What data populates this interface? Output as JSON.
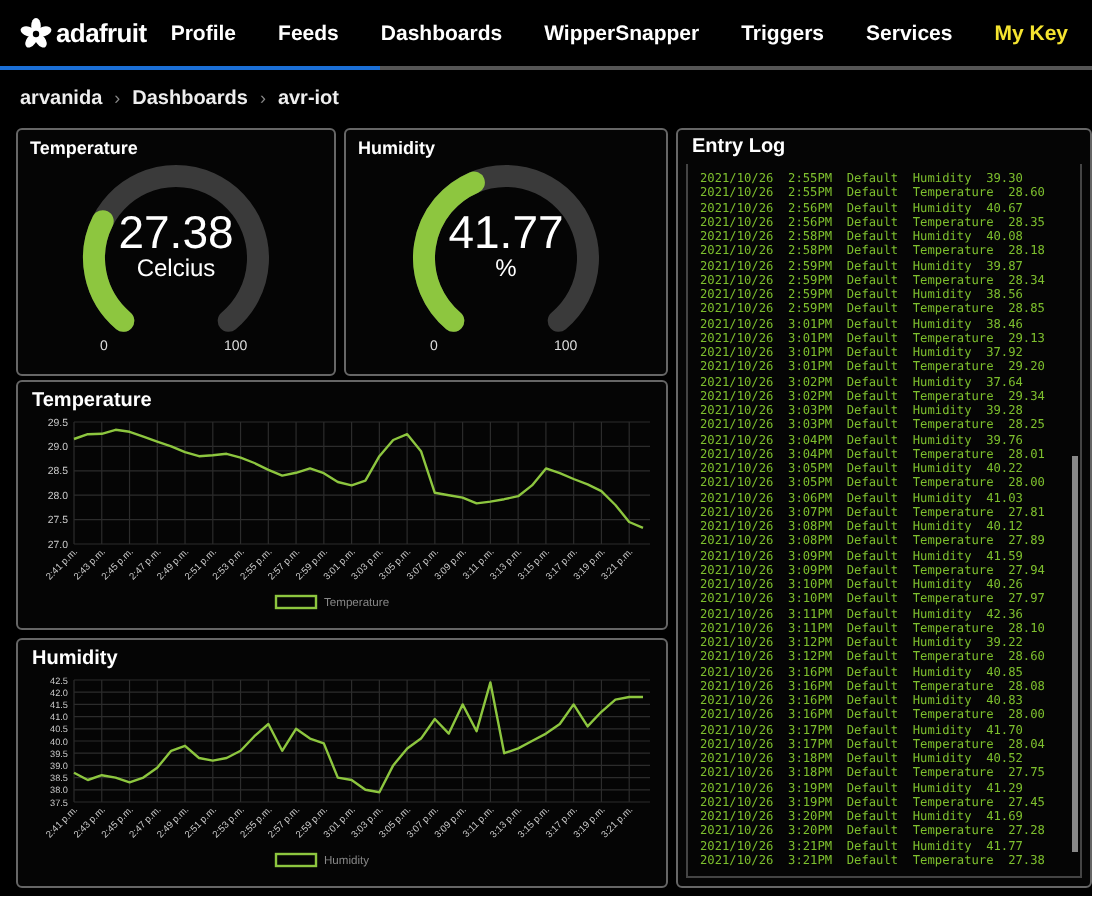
{
  "nav": {
    "logo": "adafruit",
    "items": [
      {
        "label": "Profile",
        "highlight": false
      },
      {
        "label": "Feeds",
        "highlight": false
      },
      {
        "label": "Dashboards",
        "highlight": false
      },
      {
        "label": "WipperSnapper",
        "highlight": false
      },
      {
        "label": "Triggers",
        "highlight": false
      },
      {
        "label": "Services",
        "highlight": false
      },
      {
        "label": "My Key",
        "highlight": true
      }
    ]
  },
  "breadcrumb": [
    {
      "kind": "link",
      "text": "arvanida"
    },
    {
      "kind": "separator",
      "text": "›"
    },
    {
      "kind": "link",
      "text": "Dashboards"
    },
    {
      "kind": "separator",
      "text": "›"
    },
    {
      "kind": "current",
      "text": "avr-iot"
    }
  ],
  "gauges": [
    {
      "title": "Temperature",
      "value": "27.38",
      "unit": "Celcius",
      "min": "0",
      "max": "100"
    },
    {
      "title": "Humidity",
      "value": "41.77",
      "unit": "%",
      "min": "0",
      "max": "100"
    }
  ],
  "charts": [
    {
      "title": "Temperature",
      "chart_data": {
        "type": "line",
        "grid": true,
        "ylim": [
          27,
          29.5
        ],
        "categories": [
          "2:41 p.m.",
          null,
          "2:43 p.m.",
          null,
          "2:45 p.m.",
          null,
          "2:47 p.m.",
          null,
          "2:49 p.m.",
          null,
          "2:51 p.m.",
          null,
          "2:53 p.m.",
          null,
          "2:55 p.m.",
          null,
          "2:57 p.m.",
          null,
          "2:59 p.m.",
          null,
          "3:01 p.m.",
          null,
          "3:03 p.m.",
          null,
          "3:05 p.m.",
          null,
          "3:07 p.m.",
          null,
          "3:09 p.m.",
          null,
          "3:11 p.m.",
          null,
          "3:13 p.m.",
          null,
          "3:15 p.m.",
          null,
          "3:17 p.m.",
          null,
          "3:19 p.m.",
          null,
          "3:21 p.m.",
          null
        ],
        "series": [
          {
            "name": "Temperature",
            "color": "#8dc63f",
            "values": [
              29.15,
              29.25,
              29.26,
              29.34,
              29.3,
              29.2,
              29.1,
              29.0,
              28.88,
              28.8,
              28.82,
              28.85,
              28.77,
              28.66,
              28.52,
              28.4,
              28.46,
              28.55,
              28.45,
              28.27,
              28.2,
              28.3,
              28.8,
              29.13,
              29.25,
              28.9,
              28.05,
              28.0,
              27.95,
              27.83,
              27.87,
              27.92,
              27.98,
              28.2,
              28.55,
              28.45,
              28.33,
              28.22,
              28.08,
              27.8,
              27.45,
              27.33
            ]
          }
        ],
        "yticks": [
          {
            "value": 27,
            "label": "27.0"
          },
          {
            "value": 27.5,
            "label": "27.5"
          },
          {
            "value": 28,
            "label": "28.0"
          },
          {
            "value": 28.5,
            "label": "28.5"
          },
          {
            "value": 29,
            "label": "29.0"
          },
          {
            "value": 29.5,
            "label": "29.5"
          }
        ]
      }
    },
    {
      "title": "Humidity",
      "chart_data": {
        "type": "line",
        "grid": true,
        "ylim": [
          37.5,
          42.5
        ],
        "categories": [
          "2:41 p.m.",
          null,
          "2:43 p.m.",
          null,
          "2:45 p.m.",
          null,
          "2:47 p.m.",
          null,
          "2:49 p.m.",
          null,
          "2:51 p.m.",
          null,
          "2:53 p.m.",
          null,
          "2:55 p.m.",
          null,
          "2:57 p.m.",
          null,
          "2:59 p.m.",
          null,
          "3:01 p.m.",
          null,
          "3:03 p.m.",
          null,
          "3:05 p.m.",
          null,
          "3:07 p.m.",
          null,
          "3:09 p.m.",
          null,
          "3:11 p.m.",
          null,
          "3:13 p.m.",
          null,
          "3:15 p.m.",
          null,
          "3:17 p.m.",
          null,
          "3:19 p.m.",
          null,
          "3:21 p.m.",
          null
        ],
        "series": [
          {
            "name": "Humidity",
            "color": "#8dc63f",
            "values": [
              38.7,
              38.4,
              38.6,
              38.5,
              38.3,
              38.5,
              38.9,
              39.6,
              39.8,
              39.3,
              39.2,
              39.3,
              39.6,
              40.2,
              40.7,
              39.6,
              40.5,
              40.1,
              39.9,
              38.5,
              38.4,
              38.0,
              37.9,
              39.0,
              39.7,
              40.1,
              40.9,
              40.3,
              41.5,
              40.4,
              42.4,
              39.5,
              39.7,
              40.0,
              40.3,
              40.7,
              41.5,
              40.6,
              41.2,
              41.7,
              41.8,
              41.8
            ]
          }
        ],
        "yticks": [
          {
            "value": 37.5,
            "label": "37.5"
          },
          {
            "value": 38,
            "label": "38.0"
          },
          {
            "value": 38.5,
            "label": "38.5"
          },
          {
            "value": 39,
            "label": "39.0"
          },
          {
            "value": 39.5,
            "label": "39.5"
          },
          {
            "value": 40,
            "label": "40.0"
          },
          {
            "value": 40.5,
            "label": "40.5"
          },
          {
            "value": 41,
            "label": "41.0"
          },
          {
            "value": 41.5,
            "label": "41.5"
          },
          {
            "value": 42,
            "label": "42.0"
          },
          {
            "value": 42.5,
            "label": "42.5"
          }
        ]
      }
    }
  ],
  "entry_log": {
    "title": "Entry Log",
    "entries": [
      "2021/10/26  2:55PM  Default  Humidity  39.30",
      "2021/10/26  2:55PM  Default  Temperature  28.60",
      "2021/10/26  2:56PM  Default  Humidity  40.67",
      "2021/10/26  2:56PM  Default  Temperature  28.35",
      "2021/10/26  2:58PM  Default  Humidity  40.08",
      "2021/10/26  2:58PM  Default  Temperature  28.18",
      "2021/10/26  2:59PM  Default  Humidity  39.87",
      "2021/10/26  2:59PM  Default  Temperature  28.34",
      "2021/10/26  2:59PM  Default  Humidity  38.56",
      "2021/10/26  2:59PM  Default  Temperature  28.85",
      "2021/10/26  3:01PM  Default  Humidity  38.46",
      "2021/10/26  3:01PM  Default  Temperature  29.13",
      "2021/10/26  3:01PM  Default  Humidity  37.92",
      "2021/10/26  3:01PM  Default  Temperature  29.20",
      "2021/10/26  3:02PM  Default  Humidity  37.64",
      "2021/10/26  3:02PM  Default  Temperature  29.34",
      "2021/10/26  3:03PM  Default  Humidity  39.28",
      "2021/10/26  3:03PM  Default  Temperature  28.25",
      "2021/10/26  3:04PM  Default  Humidity  39.76",
      "2021/10/26  3:04PM  Default  Temperature  28.01",
      "2021/10/26  3:05PM  Default  Humidity  40.22",
      "2021/10/26  3:05PM  Default  Temperature  28.00",
      "2021/10/26  3:06PM  Default  Humidity  41.03",
      "2021/10/26  3:07PM  Default  Temperature  27.81",
      "2021/10/26  3:08PM  Default  Humidity  40.12",
      "2021/10/26  3:08PM  Default  Temperature  27.89",
      "2021/10/26  3:09PM  Default  Humidity  41.59",
      "2021/10/26  3:09PM  Default  Temperature  27.94",
      "2021/10/26  3:10PM  Default  Humidity  40.26",
      "2021/10/26  3:10PM  Default  Temperature  27.97",
      "2021/10/26  3:11PM  Default  Humidity  42.36",
      "2021/10/26  3:11PM  Default  Temperature  28.10",
      "2021/10/26  3:12PM  Default  Humidity  39.22",
      "2021/10/26  3:12PM  Default  Temperature  28.60",
      "2021/10/26  3:16PM  Default  Humidity  40.85",
      "2021/10/26  3:16PM  Default  Temperature  28.08",
      "2021/10/26  3:16PM  Default  Humidity  40.83",
      "2021/10/26  3:16PM  Default  Temperature  28.00",
      "2021/10/26  3:17PM  Default  Humidity  41.70",
      "2021/10/26  3:17PM  Default  Temperature  28.04",
      "2021/10/26  3:18PM  Default  Humidity  40.52",
      "2021/10/26  3:18PM  Default  Temperature  27.75",
      "2021/10/26  3:19PM  Default  Humidity  41.29",
      "2021/10/26  3:19PM  Default  Temperature  27.45",
      "2021/10/26  3:20PM  Default  Humidity  41.69",
      "2021/10/26  3:20PM  Default  Temperature  27.28",
      "2021/10/26  3:21PM  Default  Humidity  41.77",
      "2021/10/26  3:21PM  Default  Temperature  27.38"
    ]
  }
}
